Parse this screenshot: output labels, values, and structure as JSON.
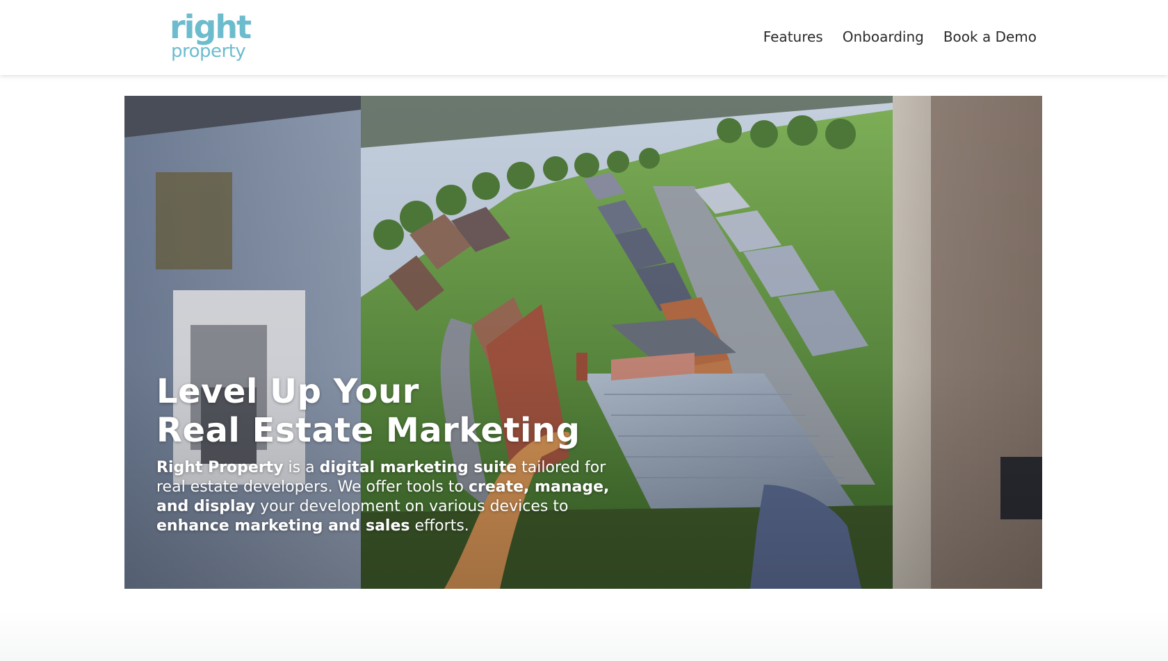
{
  "header": {
    "logo": {
      "top": "right",
      "bottom": "property"
    },
    "nav": [
      {
        "label": "Features"
      },
      {
        "label": "Onboarding"
      },
      {
        "label": "Book a Demo"
      }
    ]
  },
  "hero": {
    "title_line1": "Level Up Your",
    "title_line2": "Real Estate Marketing",
    "desc": {
      "p1": "Right Property",
      "p2": " is a ",
      "p3": "digital marketing suite",
      "p4": " tailored for real estate developers. We offer tools to ",
      "p5": "create, manage, and display",
      "p6": " your development on various devices to ",
      "p7": "enhance marketing and sales",
      "p8": " efforts."
    }
  },
  "colors": {
    "brand": "#6cbccd",
    "nav_text": "#2a2a2a",
    "hero_text": "#ffffff"
  }
}
